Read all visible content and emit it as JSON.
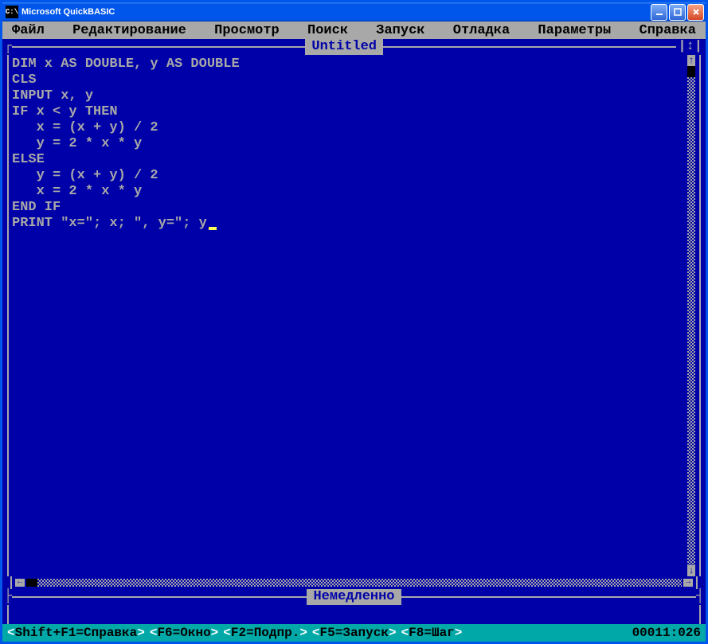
{
  "window": {
    "title": "Microsoft QuickBASIC",
    "icon_text": "C:\\"
  },
  "menu": {
    "items": [
      "Файл",
      "Редактирование",
      "Просмотр",
      "Поиск",
      "Запуск",
      "Отладка",
      "Параметры",
      "Справка"
    ]
  },
  "editor": {
    "title": "Untitled",
    "code": "DIM x AS DOUBLE, y AS DOUBLE\nCLS\nINPUT x, y\nIF x < y THEN\n   x = (x + y) / 2\n   y = 2 * x * y\nELSE\n   y = (x + y) / 2\n   x = 2 * x * y\nEND IF\nPRINT \"x=\"; x; \", y=\"; y"
  },
  "immediate": {
    "title": "Немедленно"
  },
  "status": {
    "hints": [
      {
        "pre": "<",
        "key": "Shift+F1=Справка",
        "post": ">"
      },
      {
        "pre": "<",
        "key": "F6=Окно",
        "post": ">"
      },
      {
        "pre": "<",
        "key": "F2=Подпр.",
        "post": ">"
      },
      {
        "pre": "<",
        "key": "F5=Запуск",
        "post": ">"
      },
      {
        "pre": "<",
        "key": "F8=Шаг",
        "post": ">"
      }
    ],
    "position": "00011:026"
  }
}
